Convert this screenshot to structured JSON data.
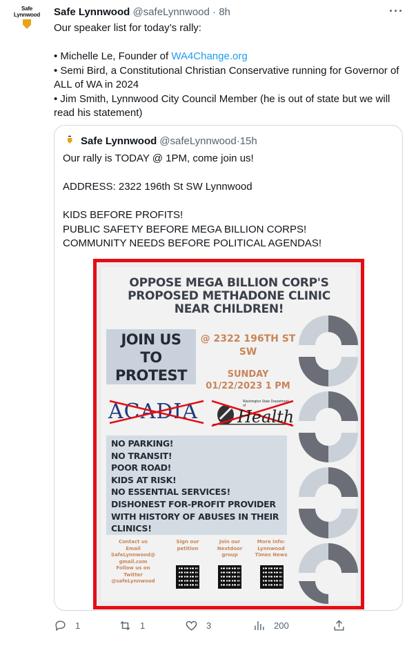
{
  "tweet": {
    "avatar_text_1": "Safe",
    "avatar_text_2": "Lynnwood",
    "name": "Safe Lynnwood",
    "handle": "@safeLynnwood",
    "separator": "·",
    "time": "8h",
    "more_icon": "more-horizontal-icon",
    "lines": [
      "Our speaker list for today’s rally:",
      "",
      "• Michelle Le, Founder of ",
      "• Semi Bird, a Constitutional Christian Conservative running for Governor of ALL of WA in 2024",
      "• Jim Smith, Lynnwood City Council Member (he is out of state but we will read his statement)"
    ],
    "link": "WA4Change.org"
  },
  "quote": {
    "name": "Safe Lynnwood",
    "handle": "@safeLynnwood",
    "separator": "·",
    "time": "15h",
    "lines": [
      "Our rally is TODAY @ 1PM, come join us!",
      "",
      "ADDRESS: 2322 196th St SW Lynnwood",
      "",
      "KIDS BEFORE PROFITS!",
      "PUBLIC SAFETY BEFORE MEGA BILLION CORPS!",
      "COMMUNITY NEEDS BEFORE POLITICAL AGENDAS!"
    ]
  },
  "flyer": {
    "title_1": "OPPOSE MEGA BILLION CORP'S",
    "title_2": "PROPOSED METHADONE CLINIC",
    "title_3": "NEAR CHILDREN!",
    "join_1": "JOIN US",
    "join_2": "TO",
    "join_3": "PROTEST",
    "addr_1": "@ 2322 196TH ST",
    "addr_2": "SW",
    "date_1": "SUNDAY",
    "date_2": "01/22/2023 1 PM",
    "acadia": "ACADIA",
    "doh_small": "Washington State Department of",
    "doh_health": "Health",
    "items": [
      "NO PARKING!",
      "NO TRANSIT!",
      "POOR ROAD!",
      "KIDS AT RISK!",
      "NO ESSENTIAL SERVICES!",
      "DISHONEST FOR-PROFIT PROVIDER",
      "WITH HISTORY OF ABUSES IN THEIR",
      "CLINICS!"
    ],
    "contact": {
      "lines": [
        "Contact us",
        "Email",
        "SafeLynnwood@",
        "gmail.com",
        "Follow us on",
        "Twitter",
        "@safeLynnwood"
      ]
    },
    "petition": [
      "Sign our",
      "petition"
    ],
    "nextdoor": [
      "Join our",
      "Nextdoor",
      "group"
    ],
    "moreinfo": [
      "More info:",
      "Lynnwood",
      "Times News"
    ],
    "colors": {
      "border": "#e50d14",
      "accent": "#c98558",
      "box": "#c9d2dc",
      "shape_dark": "#6b6e76",
      "shape_light": "#c9d0d8"
    }
  },
  "actions": {
    "reply_count": "1",
    "retweet_count": "1",
    "like_count": "3",
    "views_count": "200",
    "icons": [
      "reply-icon",
      "retweet-icon",
      "like-icon",
      "views-icon",
      "share-icon"
    ]
  }
}
